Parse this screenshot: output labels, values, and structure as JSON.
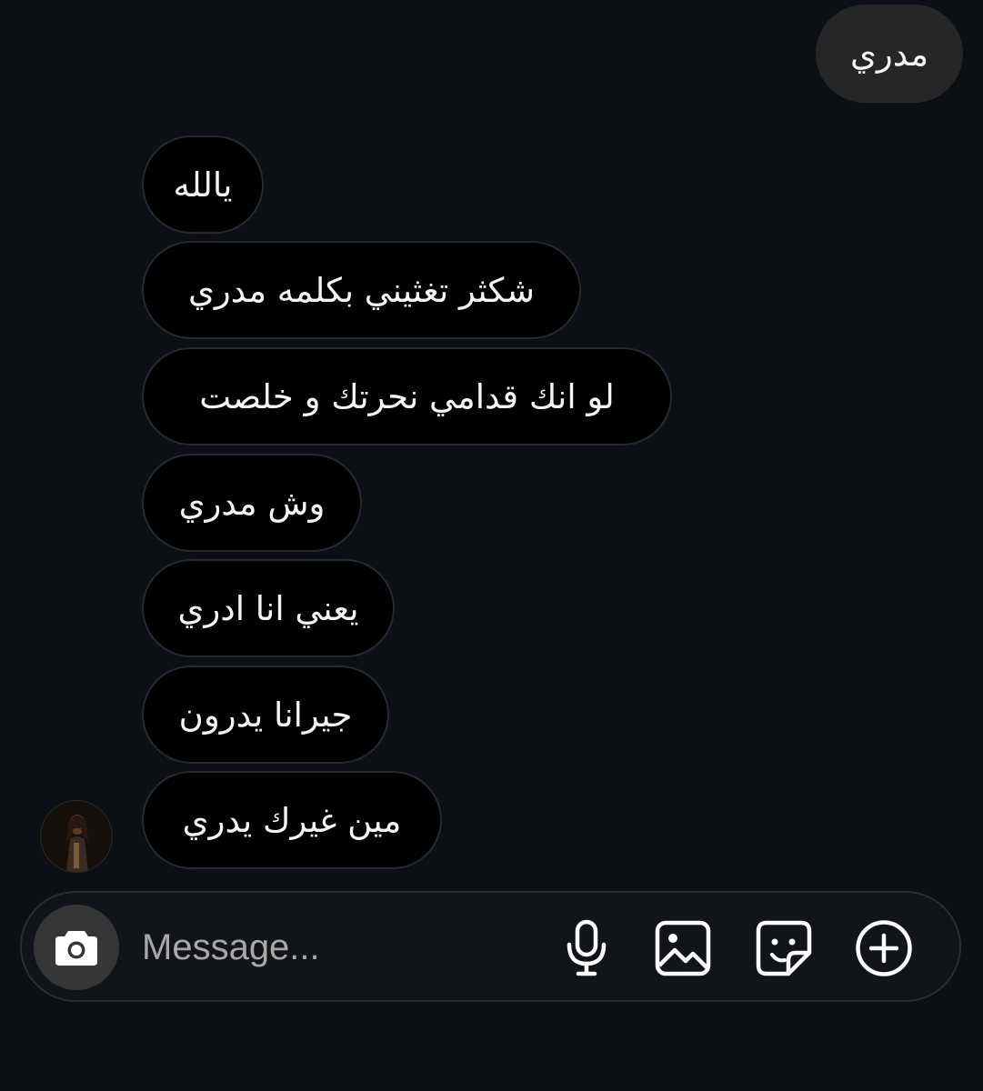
{
  "conversation": {
    "sent": [
      {
        "text": "مدري"
      }
    ],
    "received": [
      {
        "text": "يالله"
      },
      {
        "text": "شكثر تغثيني بكلمه مدري"
      },
      {
        "text": "لو انك قدامي نحرتك و خلصت"
      },
      {
        "text": "وش مدري"
      },
      {
        "text": "يعني انا ادري"
      },
      {
        "text": "جيرانا يدرون"
      },
      {
        "text": "مين غيرك يدري"
      }
    ]
  },
  "composer": {
    "placeholder": "Message...",
    "value": "",
    "icons": [
      "camera-icon",
      "microphone-icon",
      "gallery-icon",
      "sticker-icon",
      "plus-circle-icon"
    ]
  },
  "colors": {
    "background": "#0c1014",
    "sent_bubble": "#262626",
    "received_bubble": "#000000",
    "text": "#f5f5f5",
    "placeholder": "#a8a8a8"
  }
}
